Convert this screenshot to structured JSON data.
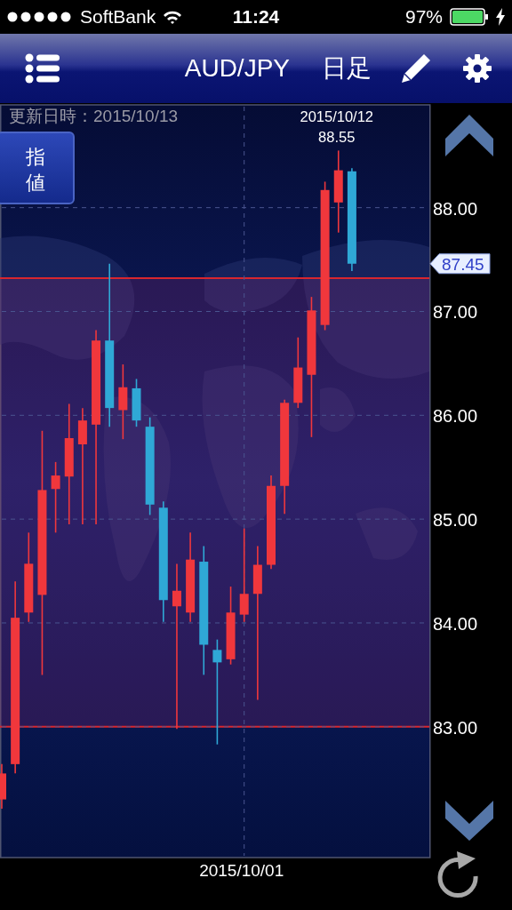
{
  "status_bar": {
    "carrier": "SoftBank",
    "time": "11:24",
    "battery": "97%"
  },
  "nav": {
    "title": "AUD/JPY",
    "period": "日足"
  },
  "updated": "更新日時：2015/10/13",
  "order_button": "指値",
  "chart_data": {
    "type": "candlestick",
    "grid": true,
    "ylim": [
      81.74,
      88.99
    ],
    "yticks": [
      {
        "value": 83,
        "label": "83.00"
      },
      {
        "value": 84,
        "label": "84.00"
      },
      {
        "value": 85,
        "label": "85.00"
      },
      {
        "value": 86,
        "label": "86.00"
      },
      {
        "value": 87,
        "label": "87.00"
      },
      {
        "value": 88,
        "label": "88.00"
      }
    ],
    "ohlc": [
      [
        82.3,
        82.64,
        82.21,
        82.55
      ],
      [
        82.64,
        84.4,
        82.55,
        84.05
      ],
      [
        84.1,
        84.87,
        84.01,
        84.57
      ],
      [
        84.27,
        85.85,
        83.5,
        85.28
      ],
      [
        85.29,
        85.55,
        84.87,
        85.42
      ],
      [
        85.41,
        86.11,
        84.95,
        85.78
      ],
      [
        85.72,
        86.07,
        84.95,
        85.95
      ],
      [
        85.91,
        86.82,
        84.95,
        86.72
      ],
      [
        86.72,
        87.46,
        85.89,
        86.07
      ],
      [
        86.05,
        86.49,
        85.77,
        86.27
      ],
      [
        86.26,
        86.35,
        85.89,
        85.95
      ],
      [
        85.89,
        85.98,
        85.04,
        85.14
      ],
      [
        85.11,
        85.17,
        84.01,
        84.22
      ],
      [
        84.16,
        84.57,
        82.98,
        84.31
      ],
      [
        84.1,
        84.87,
        84.01,
        84.61
      ],
      [
        84.59,
        84.74,
        83.5,
        83.79
      ],
      [
        83.74,
        83.84,
        82.83,
        83.62
      ],
      [
        83.65,
        84.35,
        83.6,
        84.1
      ],
      [
        84.08,
        84.91,
        84.01,
        84.28
      ],
      [
        84.28,
        84.74,
        83.26,
        84.56
      ],
      [
        84.56,
        85.42,
        84.52,
        85.32
      ],
      [
        85.32,
        86.15,
        85.05,
        86.12
      ],
      [
        86.12,
        86.75,
        86.07,
        86.46
      ],
      [
        86.39,
        87.14,
        85.79,
        87.01
      ],
      [
        86.87,
        88.25,
        86.82,
        88.17
      ],
      [
        88.05,
        88.55,
        87.76,
        88.36
      ],
      [
        88.35,
        88.38,
        87.39,
        87.46
      ]
    ],
    "ref_lines": [
      {
        "axis": "y",
        "value": 87.32
      },
      {
        "axis": "y",
        "value": 83.0
      }
    ],
    "bands": [
      {
        "axis": "y",
        "from": 83.0,
        "to": 87.32
      }
    ],
    "annotations": [
      "2015/10/01",
      "87.45",
      "2015/10/12",
      "88.55"
    ]
  }
}
